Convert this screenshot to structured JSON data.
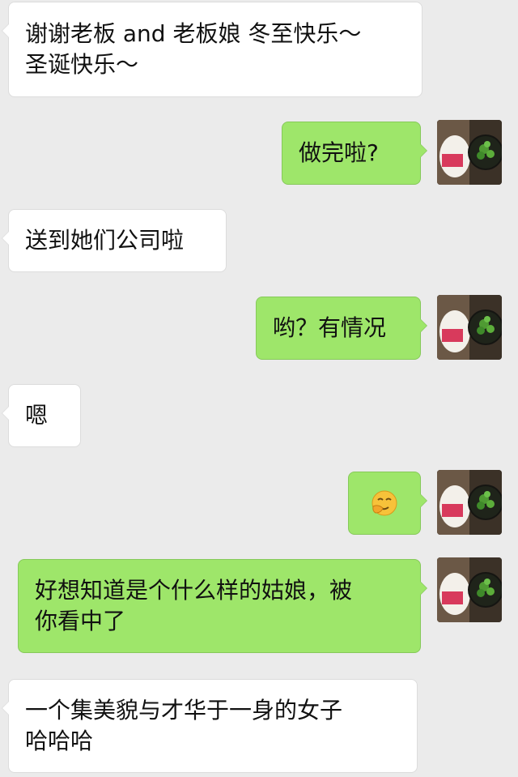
{
  "messages": [
    {
      "side": "in",
      "text": "谢谢老板 and 老板娘 冬至快乐～\n圣诞快乐～"
    },
    {
      "side": "out",
      "text": "做完啦?"
    },
    {
      "side": "in",
      "text": "送到她们公司啦"
    },
    {
      "side": "out",
      "text": "哟？有情况"
    },
    {
      "side": "in",
      "text": "嗯"
    },
    {
      "side": "out",
      "text": "",
      "emoji": "thinking-emoji"
    },
    {
      "side": "out",
      "text": "好想知道是个什么样的姑娘，被\n你看中了"
    },
    {
      "side": "in",
      "text": "一个集美貌与才华于一身的女子\n哈哈哈"
    }
  ],
  "colors": {
    "background": "#ebebeb",
    "incoming_bubble": "#ffffff",
    "outgoing_bubble": "#9ee66a"
  },
  "icons": {
    "avatar": "plant-and-drink-avatar-icon",
    "emoji": "thinking-emoji-icon"
  }
}
